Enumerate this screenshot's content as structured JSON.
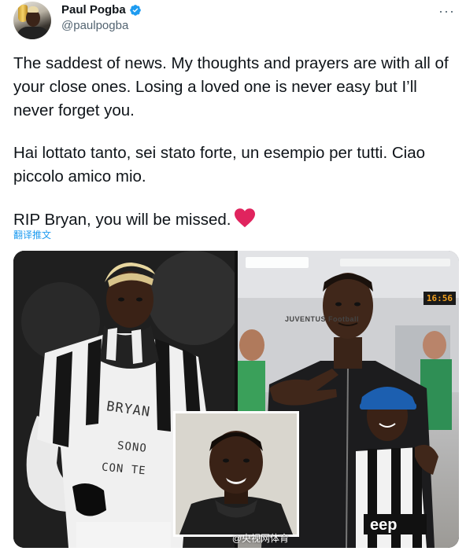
{
  "profile": {
    "display_name": "Paul Pogba",
    "handle": "@paulpogba",
    "more_menu": "···"
  },
  "tweet": {
    "paragraph1": "The saddest of news. My thoughts and prayers are with all of your close ones. Losing a loved one is never easy but I’ll never forget you.",
    "paragraph2": "Hai lottato tanto, sei stato forte, un esempio per tutti. Ciao piccolo amico mio.",
    "paragraph3": "RIP Bryan, you will be missed.",
    "translate_link": "翻译推文"
  },
  "media": {
    "shirt_line1": "BRYAN",
    "shirt_line2": "SONO",
    "shirt_line3": "CON TE",
    "clock_text": "16:56",
    "wall_sign": "JUVENTUS Football",
    "watermark": "@央视网体育"
  },
  "icons": {
    "verified": "verified-badge-icon",
    "heart": "red-heart-icon",
    "more": "more-horizontal-icon"
  },
  "colors": {
    "accent": "#1d9bf0",
    "heart": "#e0245e",
    "text": "#0f1419",
    "secondary": "#536471"
  }
}
